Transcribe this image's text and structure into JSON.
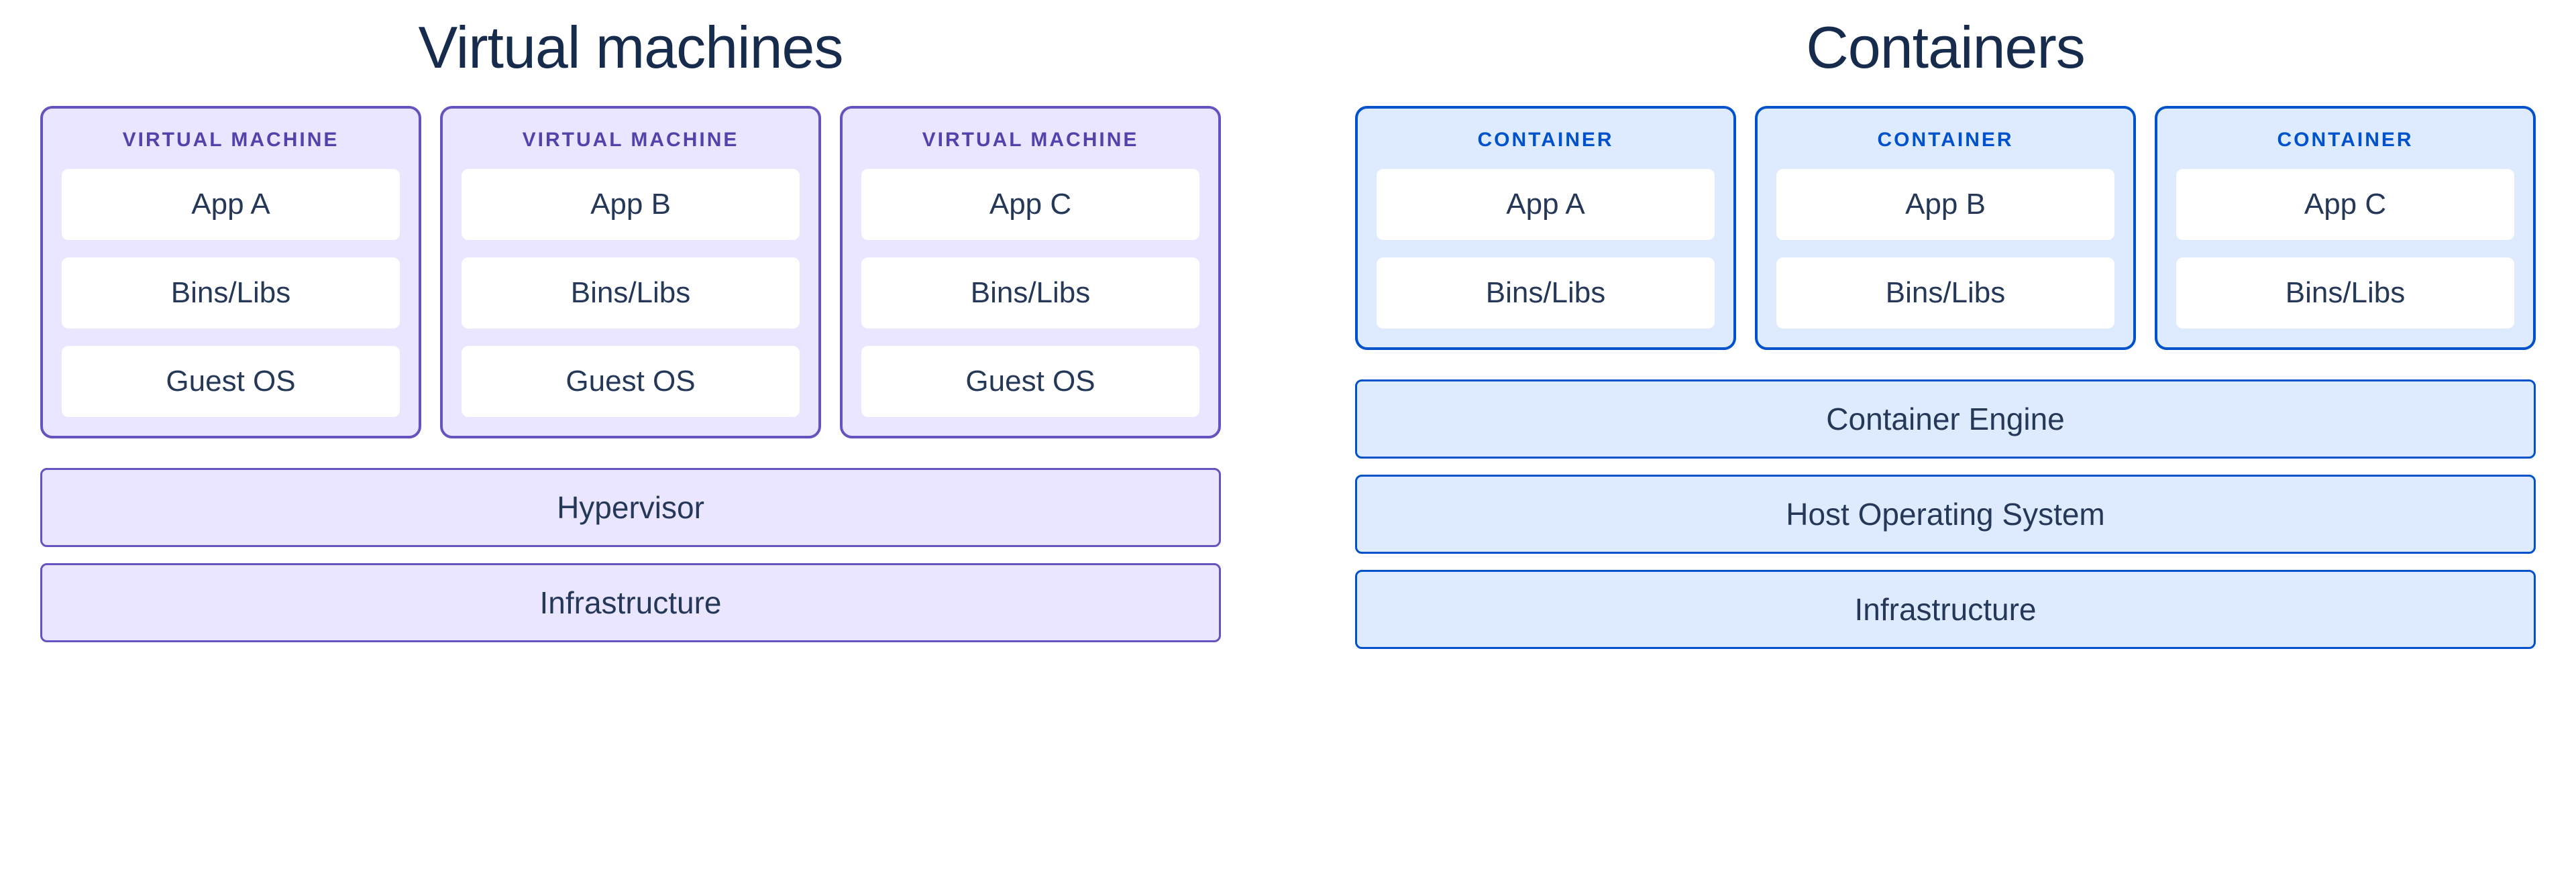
{
  "vm": {
    "title": "Virtual machines",
    "units": [
      {
        "label": "VIRTUAL MACHINE",
        "layers": [
          "App A",
          "Bins/Libs",
          "Guest OS"
        ]
      },
      {
        "label": "VIRTUAL MACHINE",
        "layers": [
          "App B",
          "Bins/Libs",
          "Guest OS"
        ]
      },
      {
        "label": "VIRTUAL MACHINE",
        "layers": [
          "App C",
          "Bins/Libs",
          "Guest OS"
        ]
      }
    ],
    "base": [
      "Hypervisor",
      "Infrastructure"
    ]
  },
  "ct": {
    "title": "Containers",
    "units": [
      {
        "label": "CONTAINER",
        "layers": [
          "App A",
          "Bins/Libs"
        ]
      },
      {
        "label": "CONTAINER",
        "layers": [
          "App B",
          "Bins/Libs"
        ]
      },
      {
        "label": "CONTAINER",
        "layers": [
          "App C",
          "Bins/Libs"
        ]
      }
    ],
    "base": [
      "Container Engine",
      "Host Operating System",
      "Infrastructure"
    ]
  }
}
